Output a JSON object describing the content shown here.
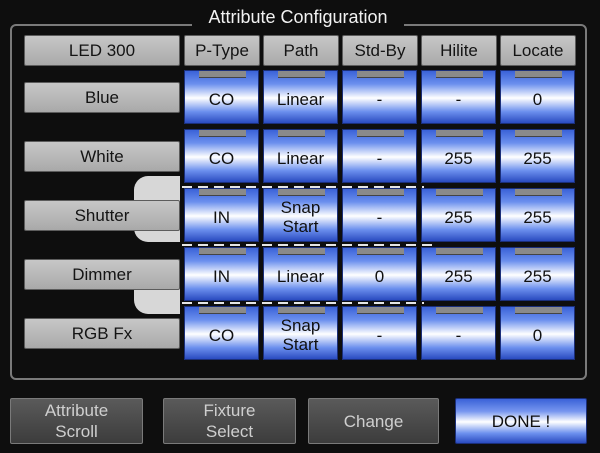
{
  "title": "Attribute Configuration",
  "device_name": "LED 300",
  "columns": [
    "P-Type",
    "Path",
    "Std-By",
    "Hilite",
    "Locate"
  ],
  "rows": [
    {
      "label": "Blue",
      "cells": [
        "CO",
        "Linear",
        "-",
        "-",
        "0"
      ]
    },
    {
      "label": "White",
      "cells": [
        "CO",
        "Linear",
        "-",
        "255",
        "255"
      ]
    },
    {
      "label": "Shutter",
      "cells": [
        "IN",
        "Snap\nStart",
        "-",
        "255",
        "255"
      ]
    },
    {
      "label": "Dimmer",
      "cells": [
        "IN",
        "Linear",
        "0",
        "255",
        "255"
      ]
    },
    {
      "label": "RGB Fx",
      "cells": [
        "CO",
        "Snap\nStart",
        "-",
        "-",
        "0"
      ]
    }
  ],
  "buttons": {
    "attribute_scroll": "Attribute\nScroll",
    "fixture_select": "Fixture\nSelect",
    "change": "Change",
    "done": "DONE !"
  }
}
